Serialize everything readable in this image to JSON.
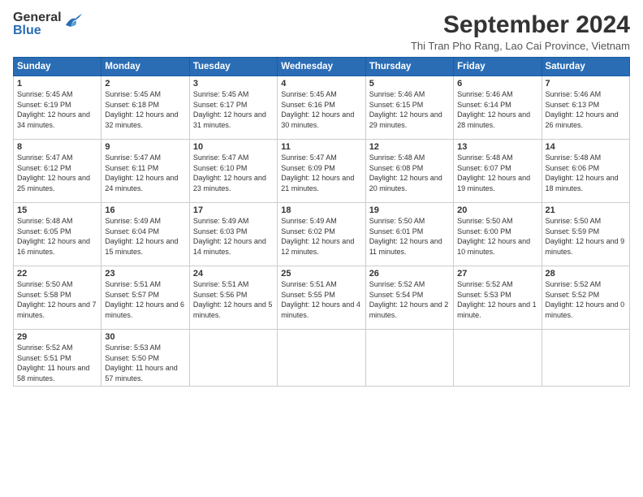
{
  "header": {
    "logo_general": "General",
    "logo_blue": "Blue",
    "month_title": "September 2024",
    "subtitle": "Thi Tran Pho Rang, Lao Cai Province, Vietnam"
  },
  "days_of_week": [
    "Sunday",
    "Monday",
    "Tuesday",
    "Wednesday",
    "Thursday",
    "Friday",
    "Saturday"
  ],
  "weeks": [
    [
      {
        "day": "1",
        "sunrise": "Sunrise: 5:45 AM",
        "sunset": "Sunset: 6:19 PM",
        "daylight": "Daylight: 12 hours and 34 minutes."
      },
      {
        "day": "2",
        "sunrise": "Sunrise: 5:45 AM",
        "sunset": "Sunset: 6:18 PM",
        "daylight": "Daylight: 12 hours and 32 minutes."
      },
      {
        "day": "3",
        "sunrise": "Sunrise: 5:45 AM",
        "sunset": "Sunset: 6:17 PM",
        "daylight": "Daylight: 12 hours and 31 minutes."
      },
      {
        "day": "4",
        "sunrise": "Sunrise: 5:45 AM",
        "sunset": "Sunset: 6:16 PM",
        "daylight": "Daylight: 12 hours and 30 minutes."
      },
      {
        "day": "5",
        "sunrise": "Sunrise: 5:46 AM",
        "sunset": "Sunset: 6:15 PM",
        "daylight": "Daylight: 12 hours and 29 minutes."
      },
      {
        "day": "6",
        "sunrise": "Sunrise: 5:46 AM",
        "sunset": "Sunset: 6:14 PM",
        "daylight": "Daylight: 12 hours and 28 minutes."
      },
      {
        "day": "7",
        "sunrise": "Sunrise: 5:46 AM",
        "sunset": "Sunset: 6:13 PM",
        "daylight": "Daylight: 12 hours and 26 minutes."
      }
    ],
    [
      {
        "day": "8",
        "sunrise": "Sunrise: 5:47 AM",
        "sunset": "Sunset: 6:12 PM",
        "daylight": "Daylight: 12 hours and 25 minutes."
      },
      {
        "day": "9",
        "sunrise": "Sunrise: 5:47 AM",
        "sunset": "Sunset: 6:11 PM",
        "daylight": "Daylight: 12 hours and 24 minutes."
      },
      {
        "day": "10",
        "sunrise": "Sunrise: 5:47 AM",
        "sunset": "Sunset: 6:10 PM",
        "daylight": "Daylight: 12 hours and 23 minutes."
      },
      {
        "day": "11",
        "sunrise": "Sunrise: 5:47 AM",
        "sunset": "Sunset: 6:09 PM",
        "daylight": "Daylight: 12 hours and 21 minutes."
      },
      {
        "day": "12",
        "sunrise": "Sunrise: 5:48 AM",
        "sunset": "Sunset: 6:08 PM",
        "daylight": "Daylight: 12 hours and 20 minutes."
      },
      {
        "day": "13",
        "sunrise": "Sunrise: 5:48 AM",
        "sunset": "Sunset: 6:07 PM",
        "daylight": "Daylight: 12 hours and 19 minutes."
      },
      {
        "day": "14",
        "sunrise": "Sunrise: 5:48 AM",
        "sunset": "Sunset: 6:06 PM",
        "daylight": "Daylight: 12 hours and 18 minutes."
      }
    ],
    [
      {
        "day": "15",
        "sunrise": "Sunrise: 5:48 AM",
        "sunset": "Sunset: 6:05 PM",
        "daylight": "Daylight: 12 hours and 16 minutes."
      },
      {
        "day": "16",
        "sunrise": "Sunrise: 5:49 AM",
        "sunset": "Sunset: 6:04 PM",
        "daylight": "Daylight: 12 hours and 15 minutes."
      },
      {
        "day": "17",
        "sunrise": "Sunrise: 5:49 AM",
        "sunset": "Sunset: 6:03 PM",
        "daylight": "Daylight: 12 hours and 14 minutes."
      },
      {
        "day": "18",
        "sunrise": "Sunrise: 5:49 AM",
        "sunset": "Sunset: 6:02 PM",
        "daylight": "Daylight: 12 hours and 12 minutes."
      },
      {
        "day": "19",
        "sunrise": "Sunrise: 5:50 AM",
        "sunset": "Sunset: 6:01 PM",
        "daylight": "Daylight: 12 hours and 11 minutes."
      },
      {
        "day": "20",
        "sunrise": "Sunrise: 5:50 AM",
        "sunset": "Sunset: 6:00 PM",
        "daylight": "Daylight: 12 hours and 10 minutes."
      },
      {
        "day": "21",
        "sunrise": "Sunrise: 5:50 AM",
        "sunset": "Sunset: 5:59 PM",
        "daylight": "Daylight: 12 hours and 9 minutes."
      }
    ],
    [
      {
        "day": "22",
        "sunrise": "Sunrise: 5:50 AM",
        "sunset": "Sunset: 5:58 PM",
        "daylight": "Daylight: 12 hours and 7 minutes."
      },
      {
        "day": "23",
        "sunrise": "Sunrise: 5:51 AM",
        "sunset": "Sunset: 5:57 PM",
        "daylight": "Daylight: 12 hours and 6 minutes."
      },
      {
        "day": "24",
        "sunrise": "Sunrise: 5:51 AM",
        "sunset": "Sunset: 5:56 PM",
        "daylight": "Daylight: 12 hours and 5 minutes."
      },
      {
        "day": "25",
        "sunrise": "Sunrise: 5:51 AM",
        "sunset": "Sunset: 5:55 PM",
        "daylight": "Daylight: 12 hours and 4 minutes."
      },
      {
        "day": "26",
        "sunrise": "Sunrise: 5:52 AM",
        "sunset": "Sunset: 5:54 PM",
        "daylight": "Daylight: 12 hours and 2 minutes."
      },
      {
        "day": "27",
        "sunrise": "Sunrise: 5:52 AM",
        "sunset": "Sunset: 5:53 PM",
        "daylight": "Daylight: 12 hours and 1 minute."
      },
      {
        "day": "28",
        "sunrise": "Sunrise: 5:52 AM",
        "sunset": "Sunset: 5:52 PM",
        "daylight": "Daylight: 12 hours and 0 minutes."
      }
    ],
    [
      {
        "day": "29",
        "sunrise": "Sunrise: 5:52 AM",
        "sunset": "Sunset: 5:51 PM",
        "daylight": "Daylight: 11 hours and 58 minutes."
      },
      {
        "day": "30",
        "sunrise": "Sunrise: 5:53 AM",
        "sunset": "Sunset: 5:50 PM",
        "daylight": "Daylight: 11 hours and 57 minutes."
      },
      null,
      null,
      null,
      null,
      null
    ]
  ]
}
